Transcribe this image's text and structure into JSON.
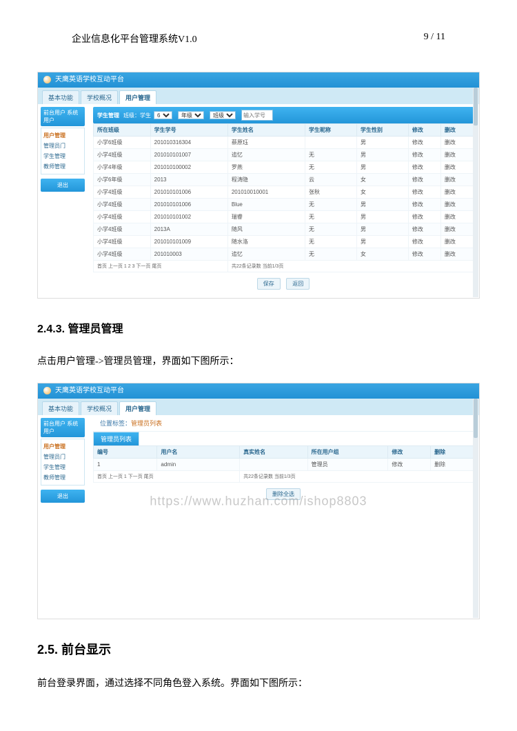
{
  "doc": {
    "title": "企业信息化平台管理系统V1.0",
    "pager": "9 / 11",
    "section1_no": "2.4.3.",
    "section1_title": "管理员管理",
    "text1_a": "点击用户管理->管理员管理，界面如下图所示：",
    "section2_no": "2.5.",
    "section2_title": "前台显示",
    "text2_a": "前台登录界面，通过选择不同角色登入系统。界面如下图所示："
  },
  "shot1": {
    "title_bar": "天鹰英语学校互动平台",
    "tabs": [
      "基本功能",
      "学校概况",
      "用户管理"
    ],
    "side_head": "前台用户  系统用户",
    "side_group": "用户管理",
    "side_items": [
      "管理员门",
      "学生管理",
      "教师管理"
    ],
    "side_btn": "退出",
    "filter_label": "学生管理",
    "filter_term": "班级：学生",
    "sel1": "6",
    "sel2": "年级",
    "sel3": "班级",
    "input_placeholder": "输入学号",
    "cols": [
      "所在班级",
      "学生学号",
      "学生姓名",
      "学生昵称",
      "学生性别",
      "修改",
      "删改"
    ],
    "rows": [
      [
        "小学6班级",
        "201010316304",
        "蔡原珏",
        "",
        "男",
        "修改",
        "删改"
      ],
      [
        "小学4班级",
        "201010101007",
        "追忆",
        "无",
        "男",
        "修改",
        "删改"
      ],
      [
        "小学4年级",
        "201010100002",
        "罗燕",
        "无",
        "男",
        "修改",
        "删改"
      ],
      [
        "小学6年级",
        "2013",
        "程涛隐",
        "云",
        "女",
        "修改",
        "删改"
      ],
      [
        "小学4班级",
        "201010101006",
        "201010010001",
        "张秋",
        "女",
        "修改",
        "删改"
      ],
      [
        "小学4班级",
        "201010101006",
        "Blue",
        "无",
        "男",
        "修改",
        "删改"
      ],
      [
        "小学4班级",
        "201010101002",
        "瑞睿",
        "无",
        "男",
        "修改",
        "删改"
      ],
      [
        "小学4班级",
        "2013A",
        "随风",
        "无",
        "男",
        "修改",
        "删改"
      ],
      [
        "小学4班级",
        "201010101009",
        "随水洛",
        "无",
        "男",
        "修改",
        "删改"
      ],
      [
        "小学4班级",
        "201010003",
        "追忆",
        "无",
        "女",
        "修改",
        "删改"
      ]
    ],
    "foot_left": "首页 上一页 1 2 3 下一页 尾页",
    "foot_right": "共22条记录数 当前1/3页",
    "btn1": "保存",
    "btn2": "返回"
  },
  "shot2": {
    "title_bar": "天鹰英语学校互动平台",
    "tabs": [
      "基本功能",
      "学校概况",
      "用户管理"
    ],
    "crumb_a": "位置标签：",
    "crumb_b": "管理员列表",
    "side_head": "前台用户  系统用户",
    "side_group": "用户管理",
    "side_items": [
      "管理员门",
      "学生管理",
      "教师管理"
    ],
    "side_btn": "退出",
    "tab2": "管理员列表",
    "cols": [
      "编号",
      "用户名",
      "真实姓名",
      "所在用户组",
      "修改",
      "删除"
    ],
    "row": [
      "1",
      "admin",
      "",
      "管理员",
      "修改",
      "删除"
    ],
    "foot": "首页 上一页 1 下一页 尾页",
    "foot2": "共22条记录数 当前1/3页",
    "btn": "删除全选",
    "watermark": "https://www.huzhan.com/ishop8803"
  }
}
